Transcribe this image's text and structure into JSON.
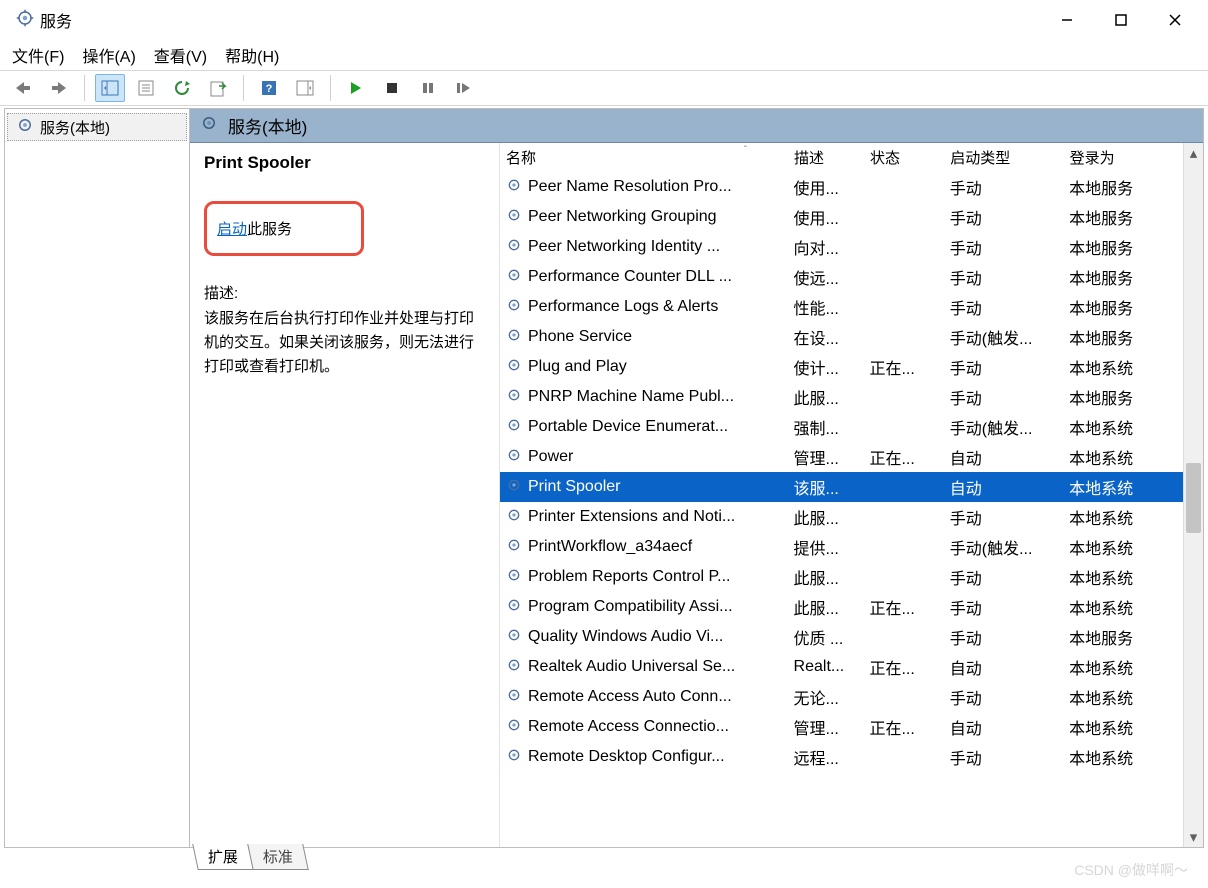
{
  "window": {
    "title": "服务"
  },
  "menu": {
    "file": "文件(F)",
    "action": "操作(A)",
    "view": "查看(V)",
    "help": "帮助(H)"
  },
  "tree": {
    "root": "服务(本地)"
  },
  "panel": {
    "header": "服务(本地)"
  },
  "detail": {
    "title": "Print Spooler",
    "start_link": "启动",
    "start_suffix": "此服务",
    "desc_label": "描述:",
    "desc_body": "该服务在后台执行打印作业并处理与打印机的交互。如果关闭该服务，则无法进行打印或查看打印机。"
  },
  "columns": {
    "name": "名称",
    "desc": "描述",
    "status": "状态",
    "startup": "启动类型",
    "logon": "登录为"
  },
  "services": [
    {
      "name": "Peer Name Resolution Pro...",
      "desc": "使用...",
      "status": "",
      "startup": "手动",
      "logon": "本地服务"
    },
    {
      "name": "Peer Networking Grouping",
      "desc": "使用...",
      "status": "",
      "startup": "手动",
      "logon": "本地服务"
    },
    {
      "name": "Peer Networking Identity ...",
      "desc": "向对...",
      "status": "",
      "startup": "手动",
      "logon": "本地服务"
    },
    {
      "name": "Performance Counter DLL ...",
      "desc": "使远...",
      "status": "",
      "startup": "手动",
      "logon": "本地服务"
    },
    {
      "name": "Performance Logs & Alerts",
      "desc": "性能...",
      "status": "",
      "startup": "手动",
      "logon": "本地服务"
    },
    {
      "name": "Phone Service",
      "desc": "在设...",
      "status": "",
      "startup": "手动(触发...",
      "logon": "本地服务"
    },
    {
      "name": "Plug and Play",
      "desc": "使计...",
      "status": "正在...",
      "startup": "手动",
      "logon": "本地系统"
    },
    {
      "name": "PNRP Machine Name Publ...",
      "desc": "此服...",
      "status": "",
      "startup": "手动",
      "logon": "本地服务"
    },
    {
      "name": "Portable Device Enumerat...",
      "desc": "强制...",
      "status": "",
      "startup": "手动(触发...",
      "logon": "本地系统"
    },
    {
      "name": "Power",
      "desc": "管理...",
      "status": "正在...",
      "startup": "自动",
      "logon": "本地系统"
    },
    {
      "name": "Print Spooler",
      "desc": "该服...",
      "status": "",
      "startup": "自动",
      "logon": "本地系统",
      "selected": true
    },
    {
      "name": "Printer Extensions and Noti...",
      "desc": "此服...",
      "status": "",
      "startup": "手动",
      "logon": "本地系统"
    },
    {
      "name": "PrintWorkflow_a34aecf",
      "desc": "提供...",
      "status": "",
      "startup": "手动(触发...",
      "logon": "本地系统"
    },
    {
      "name": "Problem Reports Control P...",
      "desc": "此服...",
      "status": "",
      "startup": "手动",
      "logon": "本地系统"
    },
    {
      "name": "Program Compatibility Assi...",
      "desc": "此服...",
      "status": "正在...",
      "startup": "手动",
      "logon": "本地系统"
    },
    {
      "name": "Quality Windows Audio Vi...",
      "desc": "优质 ...",
      "status": "",
      "startup": "手动",
      "logon": "本地服务"
    },
    {
      "name": "Realtek Audio Universal Se...",
      "desc": "Realt...",
      "status": "正在...",
      "startup": "自动",
      "logon": "本地系统"
    },
    {
      "name": "Remote Access Auto Conn...",
      "desc": "无论...",
      "status": "",
      "startup": "手动",
      "logon": "本地系统"
    },
    {
      "name": "Remote Access Connectio...",
      "desc": "管理...",
      "status": "正在...",
      "startup": "自动",
      "logon": "本地系统"
    },
    {
      "name": "Remote Desktop Configur...",
      "desc": "远程...",
      "status": "",
      "startup": "手动",
      "logon": "本地系统"
    }
  ],
  "tabs": {
    "extended": "扩展",
    "standard": "标准"
  },
  "watermark": "CSDN @做咩啊～"
}
